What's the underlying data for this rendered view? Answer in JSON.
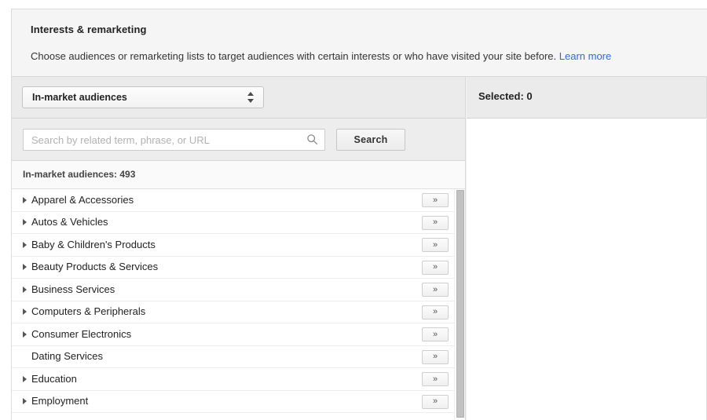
{
  "module": {
    "title": "Interests & remarketing",
    "description": "Choose audiences or remarketing lists to target audiences with certain interests or who have visited your site before.",
    "learn_more_label": "Learn more",
    "link_color": "#3367d6"
  },
  "audience_type_select": {
    "selected_value": "In-market audiences",
    "options": [
      "In-market audiences"
    ],
    "icon": "chevron-updown-icon"
  },
  "search": {
    "value": "",
    "placeholder": "Search by related term, phrase, or URL",
    "icon": "search-icon",
    "button_label": "Search"
  },
  "list_header": {
    "text": "In-market audiences: 493",
    "label": "In-market audiences",
    "count": 493
  },
  "list": {
    "expand_button_label": "»",
    "rows": [
      {
        "label": "Apparel & Accessories",
        "expandable": true
      },
      {
        "label": "Autos & Vehicles",
        "expandable": true
      },
      {
        "label": "Baby & Children's Products",
        "expandable": true
      },
      {
        "label": "Beauty Products & Services",
        "expandable": true
      },
      {
        "label": "Business Services",
        "expandable": true
      },
      {
        "label": "Computers & Peripherals",
        "expandable": true
      },
      {
        "label": "Consumer Electronics",
        "expandable": true
      },
      {
        "label": "Dating Services",
        "expandable": false
      },
      {
        "label": "Education",
        "expandable": true
      },
      {
        "label": "Employment",
        "expandable": true
      }
    ]
  },
  "selected_panel": {
    "header": "Selected: 0",
    "count": 0,
    "items": []
  }
}
